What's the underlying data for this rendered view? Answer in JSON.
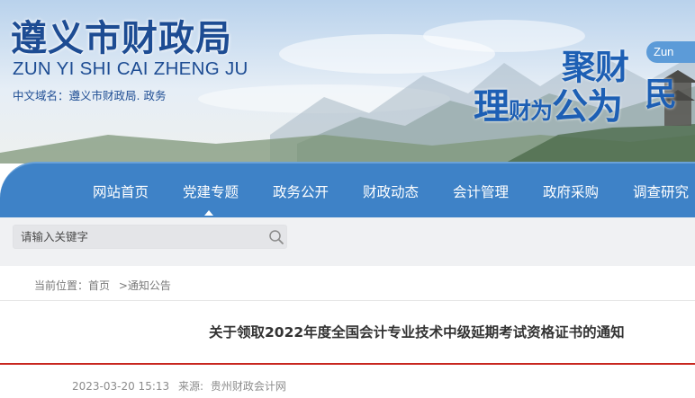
{
  "header": {
    "site_title": "遵义市财政局",
    "site_pinyin": "ZUN YI SHI CAI ZHENG JU",
    "domain_line": "中文域名：遵义市财政局. 政务",
    "slogan": {
      "line1": "聚财",
      "line2_big1": "理",
      "line2_small": "财为",
      "line2_big2": "公为",
      "line2_end": "民"
    },
    "badge": "Zun"
  },
  "nav": {
    "items": [
      {
        "label": "网站首页"
      },
      {
        "label": "党建专题"
      },
      {
        "label": "政务公开"
      },
      {
        "label": "财政动态"
      },
      {
        "label": "会计管理"
      },
      {
        "label": "政府采购"
      },
      {
        "label": "调查研究"
      }
    ],
    "active_index": 1
  },
  "search": {
    "placeholder": "请输入关键字"
  },
  "breadcrumb": {
    "prefix": "当前位置：",
    "home": "首页",
    "separator": ">",
    "current": "通知公告"
  },
  "article": {
    "title": "关于领取2022年度全国会计专业技术中级延期考试资格证书的通知",
    "datetime": "2023-03-20 15:13",
    "source_label": "来源:",
    "source": "贵州财政会计网"
  },
  "colors": {
    "brand_blue": "#1d4c93",
    "nav_blue": "#3e82c7",
    "accent_red": "#c8271f"
  },
  "icons": {
    "search": "search-icon",
    "nav_caret": "caret-up-icon"
  }
}
